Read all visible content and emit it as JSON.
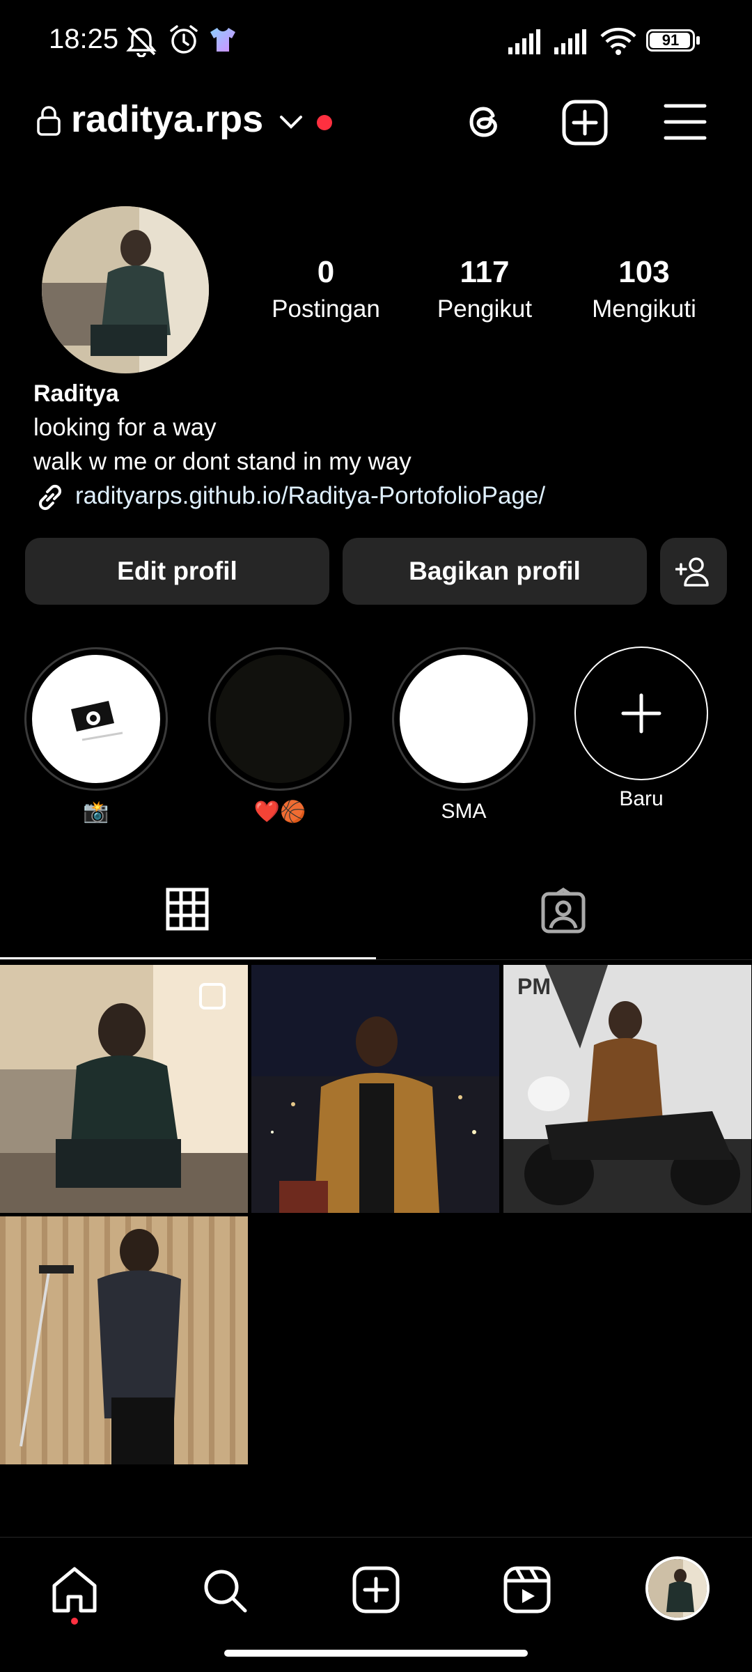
{
  "status_bar": {
    "time": "18:25",
    "battery": "91"
  },
  "header": {
    "username": "raditya.rps",
    "icons": [
      "lock-icon",
      "chevron-down-icon",
      "threads-icon",
      "add-post-icon",
      "menu-icon"
    ]
  },
  "profile": {
    "stats": [
      {
        "value": "0",
        "label": "Postingan"
      },
      {
        "value": "117",
        "label": "Pengikut"
      },
      {
        "value": "103",
        "label": "Mengikuti"
      }
    ],
    "name": "Raditya",
    "bio_lines": [
      "looking for a way",
      "walk w me or dont stand in my way"
    ],
    "link": "radityarps.github.io/Raditya-PortofolioPage/"
  },
  "buttons": {
    "edit": "Edit profil",
    "share": "Bagikan profil"
  },
  "highlights": [
    {
      "label": "📸"
    },
    {
      "label": "❤️🏀"
    },
    {
      "label": "SMA"
    },
    {
      "label": "Baru"
    }
  ],
  "tabs": [
    "grid-icon",
    "tagged-icon"
  ],
  "bottom_nav": [
    "home-icon",
    "search-icon",
    "create-icon",
    "reels-icon",
    "profile-avatar"
  ],
  "colors": {
    "background": "#000000",
    "button_bg": "#262626",
    "notification": "#ff3040"
  }
}
